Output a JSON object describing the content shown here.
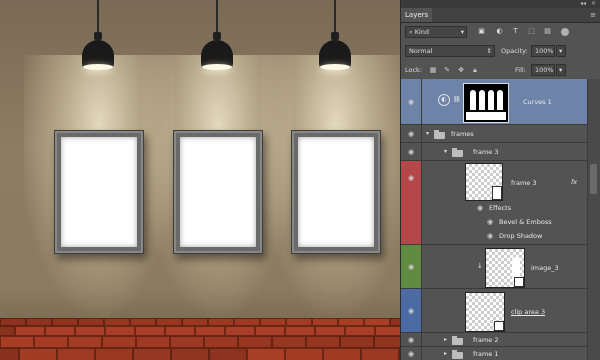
{
  "panel": {
    "tab_label": "Layers",
    "filter_kind": "Kind",
    "blend_mode": "Normal",
    "opacity_label": "Opacity:",
    "opacity_value": "100%",
    "lock_label": "Lock:",
    "fill_label": "Fill:",
    "fill_value": "100%"
  },
  "layers": {
    "curves": "Curves 1",
    "frames_group": "frames",
    "frame3_group": "frame 3",
    "frame3_layer": "frame 3",
    "fx_badge": "fx",
    "effects": "Effects",
    "bevel": "Bevel & Emboss",
    "drop_shadow": "Drop Shadow",
    "image3": "image_3",
    "clip3": "clip area 3",
    "frame2_group": "frame 2",
    "frame1_group": "frame 1"
  },
  "colors": {
    "selected_layer": "#6d84a8",
    "frame3_tag": "#b44848",
    "image3_tag": "#5f8a3f",
    "clip3_tag": "#4a6ba3"
  }
}
